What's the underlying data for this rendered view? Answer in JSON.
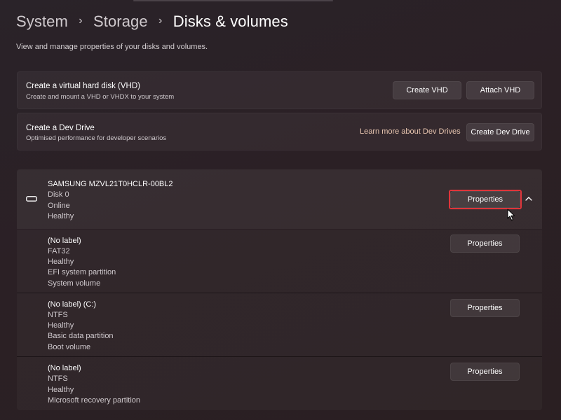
{
  "breadcrumb": {
    "items": [
      "System",
      "Storage",
      "Disks & volumes"
    ],
    "separator": "›"
  },
  "subtitle": "View and manage properties of your disks and volumes.",
  "vhd_card": {
    "title": "Create a virtual hard disk (VHD)",
    "description": "Create and mount a VHD or VHDX to your system",
    "create_button": "Create VHD",
    "attach_button": "Attach VHD"
  },
  "dev_drive_card": {
    "title": "Create a Dev Drive",
    "description": "Optimised performance for developer scenarios",
    "learn_more_link": "Learn more about Dev Drives",
    "create_button": "Create Dev Drive"
  },
  "disk": {
    "name": "SAMSUNG MZVL21T0HCLR-00BL2",
    "number": "Disk 0",
    "status": "Online",
    "health": "Healthy",
    "properties_button": "Properties",
    "icon": "drive-icon",
    "expanded": true
  },
  "volumes": [
    {
      "label": "(No label)",
      "filesystem": "FAT32",
      "health": "Healthy",
      "type": "EFI system partition",
      "role": "System volume",
      "properties_button": "Properties"
    },
    {
      "label": "(No label) (C:)",
      "filesystem": "NTFS",
      "health": "Healthy",
      "type": "Basic data partition",
      "role": "Boot volume",
      "properties_button": "Properties"
    },
    {
      "label": "(No label)",
      "filesystem": "NTFS",
      "health": "Healthy",
      "type": "Microsoft recovery partition",
      "properties_button": "Properties"
    }
  ],
  "colors": {
    "background": "#2a2227",
    "accent_link": "#e9c6b0",
    "highlight_box": "#e0353a"
  }
}
